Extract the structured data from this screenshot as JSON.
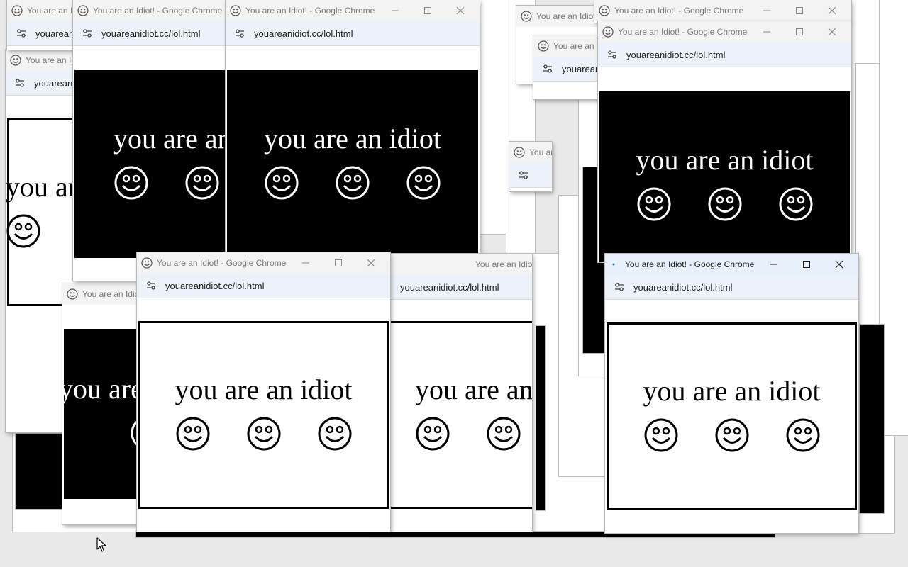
{
  "window_title": "You are an Idiot! - Google Chrome",
  "url": "youareanidiot.cc/lol.html",
  "headline": "you are an idiot",
  "controls": {
    "minimize": "minimize",
    "maximize": "maximize",
    "close": "close"
  },
  "icons": {
    "favicon": "smiley-icon",
    "site_info": "tune-icon",
    "cursor": "mouse-cursor-icon"
  },
  "colors": {
    "title_active_bg": "#e8f0fb",
    "title_inactive_bg": "#f3f3f3",
    "address_bg": "#edf2fa",
    "stage_black": "#000000",
    "stage_white": "#ffffff"
  }
}
